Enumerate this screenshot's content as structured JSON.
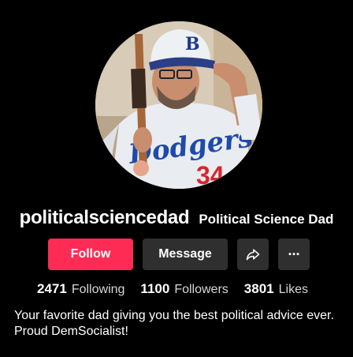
{
  "profile": {
    "username": "politicalsciencedad",
    "display_name": "Political Science Dad",
    "avatar_label": "profile-photo"
  },
  "actions": {
    "follow_label": "Follow",
    "message_label": "Message",
    "share_icon": "share-arrow-icon",
    "more_icon": "more-dots-icon",
    "more_glyph": "···"
  },
  "stats": {
    "following": {
      "value": "2471",
      "label": "Following"
    },
    "followers": {
      "value": "1100",
      "label": "Followers"
    },
    "likes": {
      "value": "3801",
      "label": "Likes"
    }
  },
  "bio": {
    "text": "Your favorite dad giving you the best political advice ever. Proud DemSocialist!"
  },
  "colors": {
    "background": "#000000",
    "follow": "#fe2c55",
    "secondary_button": "#2f2f2f"
  }
}
